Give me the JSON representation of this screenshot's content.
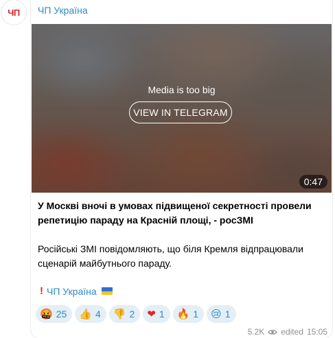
{
  "channel": {
    "name": "ЧП Україна",
    "avatar_text": "ЧП"
  },
  "media": {
    "notice": "Media is too big",
    "button_label": "VIEW IN TELEGRAM",
    "duration": "0:47"
  },
  "post": {
    "headline": "У Москві вночі в умовах підвищеної секретності провели репетицію параду на Красній площі, - росЗМІ",
    "body": "Російські ЗМІ повідомляють, що біля Кремля відпрацювали сценарій майбутнього параду.",
    "signature": "ЧП Україна"
  },
  "reactions": [
    {
      "emoji": "🤬",
      "count": "25",
      "icon": "angry-face-icon"
    },
    {
      "emoji": "👍",
      "count": "4",
      "icon": "thumbs-up-icon"
    },
    {
      "emoji": "👎",
      "count": "2",
      "icon": "thumbs-down-icon"
    },
    {
      "emoji": "❤",
      "count": "1",
      "icon": "heart-icon"
    },
    {
      "emoji": "🔥",
      "count": "1",
      "icon": "fire-icon"
    },
    {
      "emoji": "😢",
      "count": "1",
      "icon": "crying-face-icon"
    }
  ],
  "meta": {
    "views": "5.2K",
    "edited_label": "edited",
    "time": "15:05"
  },
  "colors": {
    "accent": "#2f8ac2",
    "avatar_text": "#d62b2b",
    "reaction_bg": "#e4eef6",
    "meta_text": "#8c8f93"
  }
}
